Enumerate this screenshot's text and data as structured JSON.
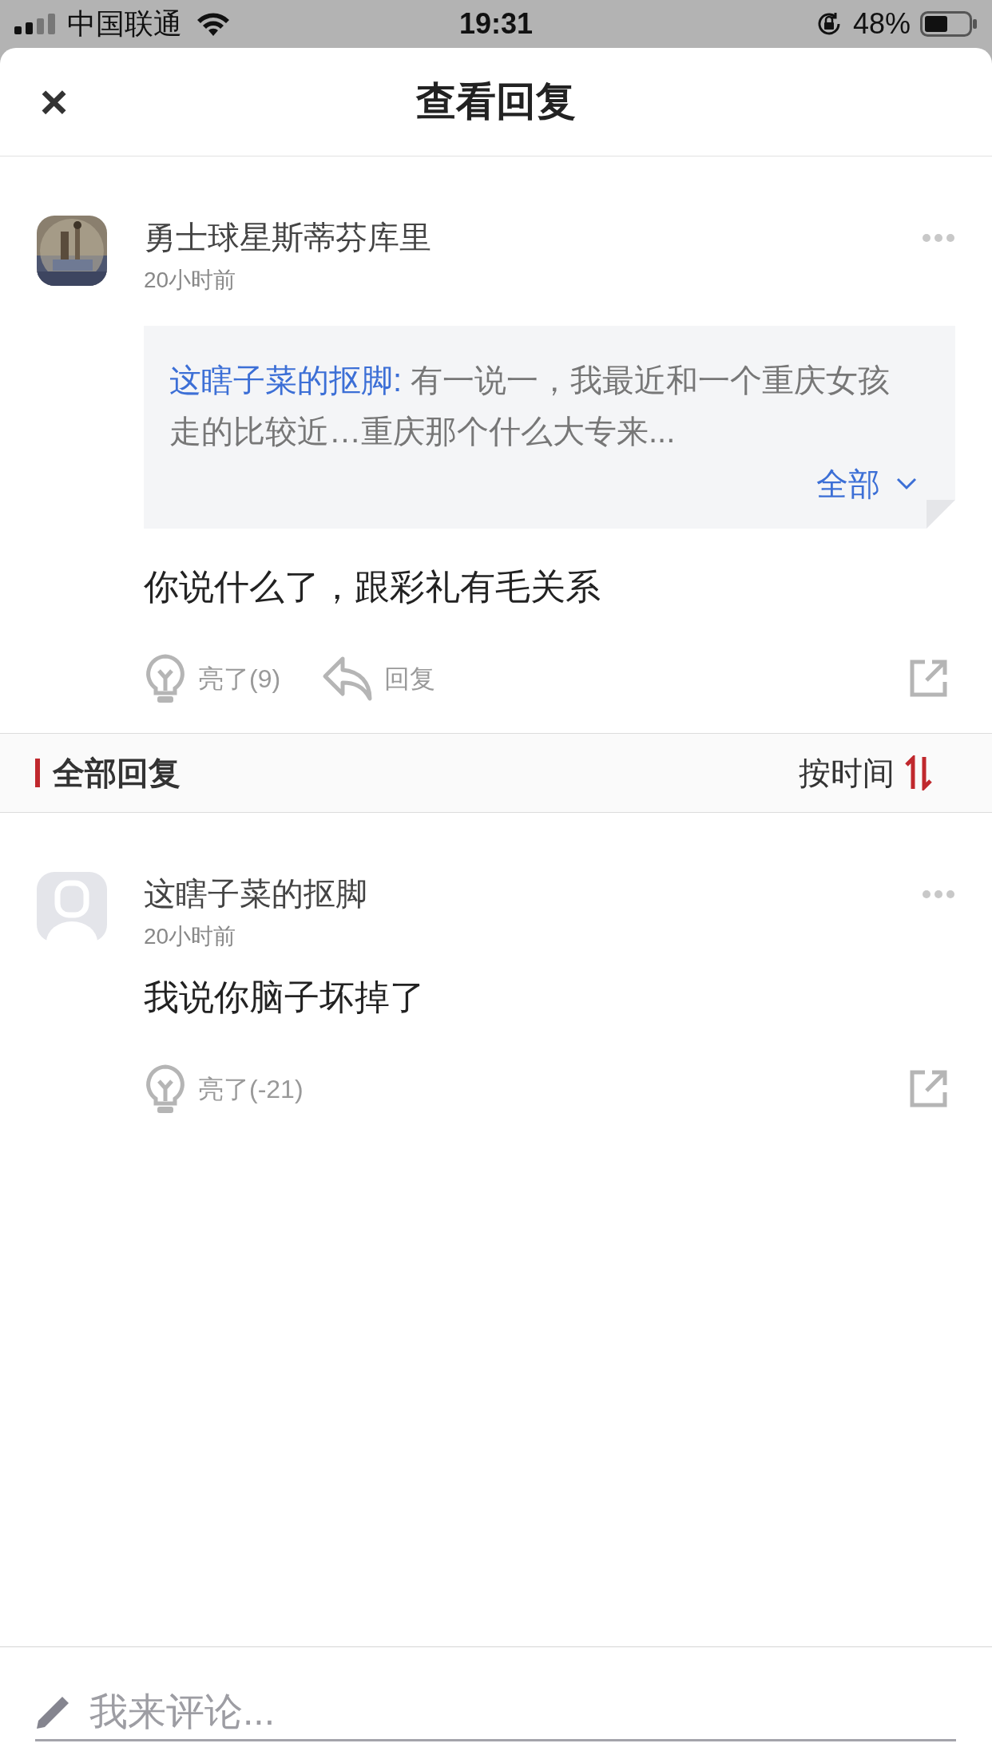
{
  "status_bar": {
    "carrier": "中国联通",
    "time": "19:31",
    "battery": "48%"
  },
  "header": {
    "close": "×",
    "title": "查看回复"
  },
  "main_comment": {
    "author": "勇士球星斯蒂芬库里",
    "time": "20小时前",
    "quote": {
      "author": "这瞎子菜的抠脚:",
      "text": "有一说一，我最近和一个重庆女孩走的比较近…重庆那个什么大专来...",
      "expand": "全部"
    },
    "text": "你说什么了，跟彩礼有毛关系",
    "likes": "亮了(9)",
    "reply": "回复"
  },
  "section": {
    "title": "全部回复",
    "sort": "按时间"
  },
  "replies": [
    {
      "avatar": {
        "kind": "default"
      },
      "author": "这瞎子菜的抠脚",
      "time": "20小时前",
      "text": "我说你脑子坏掉了",
      "likes": "亮了(-21)"
    }
  ],
  "composer": {
    "placeholder": "我来评论..."
  }
}
